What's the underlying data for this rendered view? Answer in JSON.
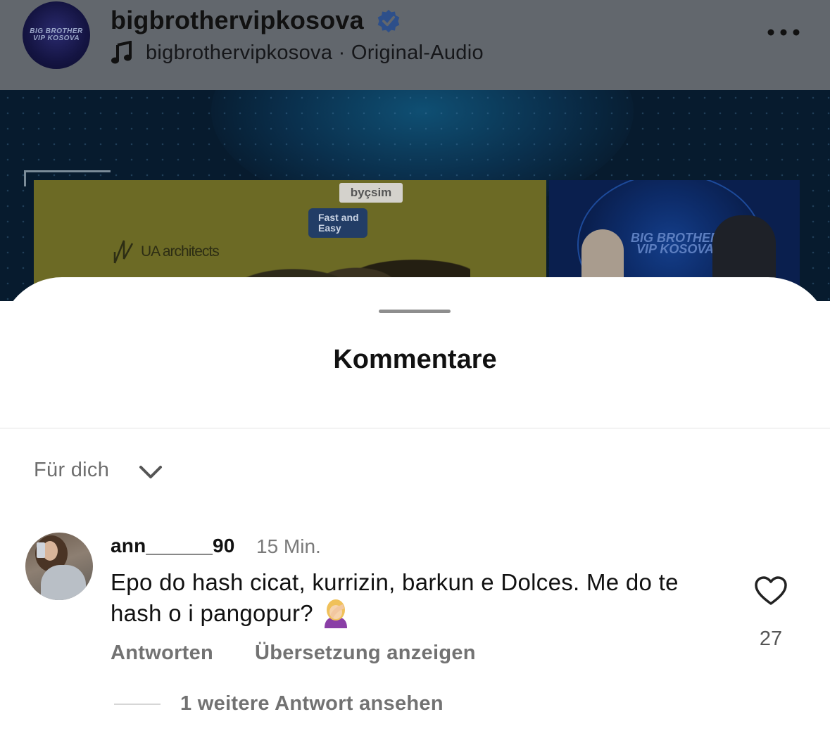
{
  "post": {
    "avatar_text_line1": "BIG BROTHER",
    "avatar_text_line2": "VIP KOSOVA",
    "username": "bigbrothervipkosova",
    "audio_line": "bigbrothervipkosova · Original-Audio",
    "video": {
      "sponsor": "byçsim",
      "sponsor_tagline": "Fast and Easy",
      "architects_sign": "UA architects",
      "show_logo": "BIG BROTHER VIP KOSOVA"
    }
  },
  "sheet": {
    "title": "Kommentare",
    "sort_label": "Für dich"
  },
  "comments": [
    {
      "username": "ann______90",
      "time": "15 Min.",
      "text": "Epo do hash cicat, kurrizin, barkun e Dolces. Me do te hash o i pangopur?",
      "likes": "27",
      "reply_label": "Antworten",
      "translate_label": "Übersetzung anzeigen",
      "more_replies_label": "1 weitere Antwort ansehen"
    }
  ],
  "colors": {
    "header_overlay": "#62676d",
    "verified_blue": "#2d4f8a",
    "muted_text": "#727272"
  },
  "icons": [
    "music-note-icon",
    "verified-badge-icon",
    "more-options-icon",
    "chevron-down-icon",
    "heart-icon",
    "facepalm-emoji-icon"
  ]
}
